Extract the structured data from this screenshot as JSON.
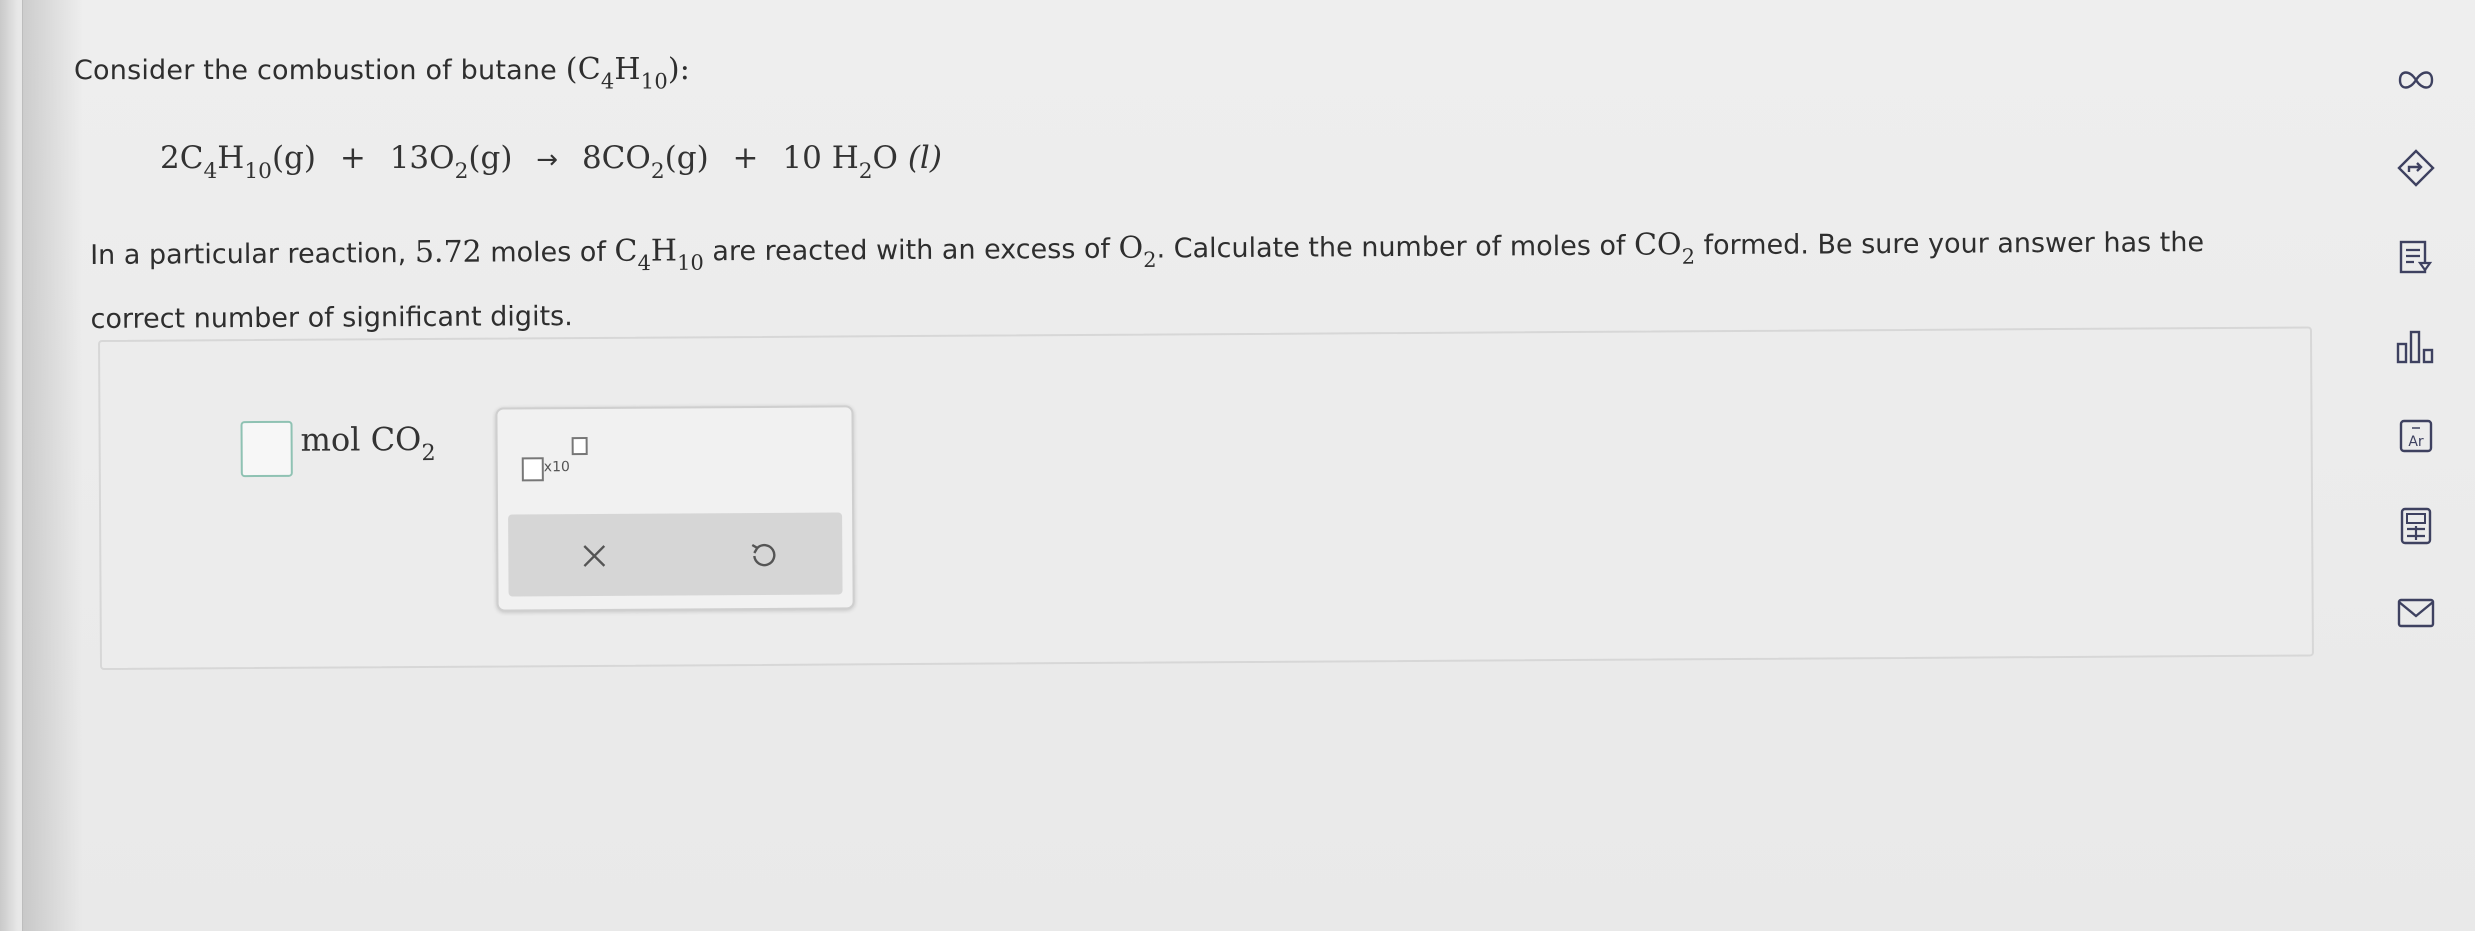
{
  "question": {
    "intro_text": "Consider the combustion of butane",
    "intro_formula": {
      "open": "(",
      "C": "C",
      "C_sub": "4",
      "H": "H",
      "H_sub": "10",
      "close": "):"
    },
    "equation": {
      "r1_coef": "2",
      "r1_C": "C",
      "r1_C_sub": "4",
      "r1_H": "H",
      "r1_H_sub": "10",
      "r1_state": "(g)",
      "plus1": "+",
      "r2_coef": "13",
      "r2_O": "O",
      "r2_O_sub": "2",
      "r2_state": "(g)",
      "arrow": "→",
      "p1_coef": "8",
      "p1_C": "CO",
      "p1_O_sub": "2",
      "p1_state": "(g)",
      "plus2": "+",
      "p2_coef": "10",
      "p2_H": "H",
      "p2_H_sub": "2",
      "p2_O": "O",
      "p2_state": "(l)"
    },
    "paragraph": {
      "t1": "In a particular reaction,",
      "moles": "5.72",
      "t2": "moles of",
      "f1_C": "C",
      "f1_C_sub": "4",
      "f1_H": "H",
      "f1_H_sub": "10",
      "t3": "are reacted with an excess of",
      "f2_O": "O",
      "f2_O_sub": "2",
      "t4": ". Calculate the number of moles of",
      "f3_CO": "CO",
      "f3_O_sub": "2",
      "t5": "formed. Be sure your answer has the",
      "t6": "correct number of significant digits."
    }
  },
  "answer": {
    "value": "",
    "unit_mol": "mol",
    "unit_CO": "CO",
    "unit_sub": "2"
  },
  "toolbox": {
    "sci_label": "x10",
    "clear_icon": "close-x-icon",
    "undo_icon": "undo-icon"
  },
  "sidebar": {
    "icons": [
      "infinity-icon",
      "arrow-circle-icon",
      "notes-icon",
      "chart-icon",
      "periodic-table-icon",
      "calculator-icon",
      "mail-icon"
    ],
    "periodic_label": "Ar"
  },
  "colors": {
    "accent": "#8fc2b3",
    "text": "#2e2e2e",
    "icon": "#4b4f6e"
  }
}
